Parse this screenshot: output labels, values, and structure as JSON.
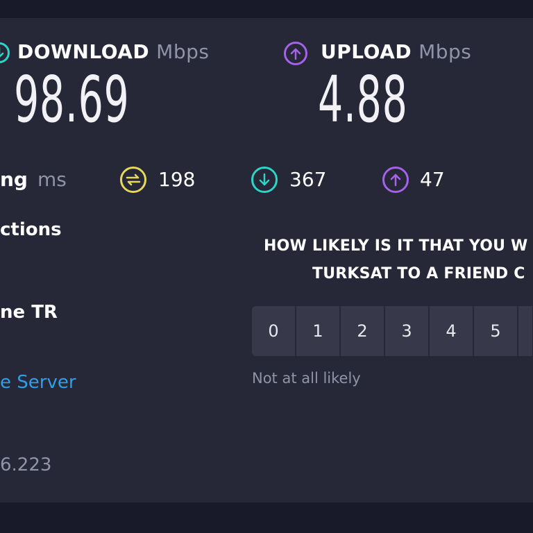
{
  "download": {
    "label": "DOWNLOAD",
    "unit": "Mbps",
    "value": "98.69",
    "icon": "arrow-down-circle-icon",
    "color": "#2bd6c8"
  },
  "upload": {
    "label": "UPLOAD",
    "unit": "Mbps",
    "value": "4.88",
    "icon": "arrow-up-circle-icon",
    "color": "#a463e8"
  },
  "ping": {
    "label": "ng",
    "unit": "ms",
    "idle": {
      "value": "198",
      "icon": "ping-idle-icon",
      "color": "#e8d85a"
    },
    "down": {
      "value": "367",
      "icon": "ping-download-icon",
      "color": "#2bd6c8"
    },
    "up": {
      "value": "47",
      "icon": "ping-upload-icon",
      "color": "#a463e8"
    }
  },
  "left": {
    "connections": "ctions",
    "isp": "ne TR",
    "server_link": "e Server",
    "ip": "6.223"
  },
  "survey": {
    "question_line1": "HOW LIKELY IS IT THAT YOU W",
    "question_line2": "TURKSAT TO A FRIEND C",
    "scale": [
      "0",
      "1",
      "2",
      "3",
      "4",
      "5",
      ""
    ],
    "low_label": "Not at all likely"
  }
}
